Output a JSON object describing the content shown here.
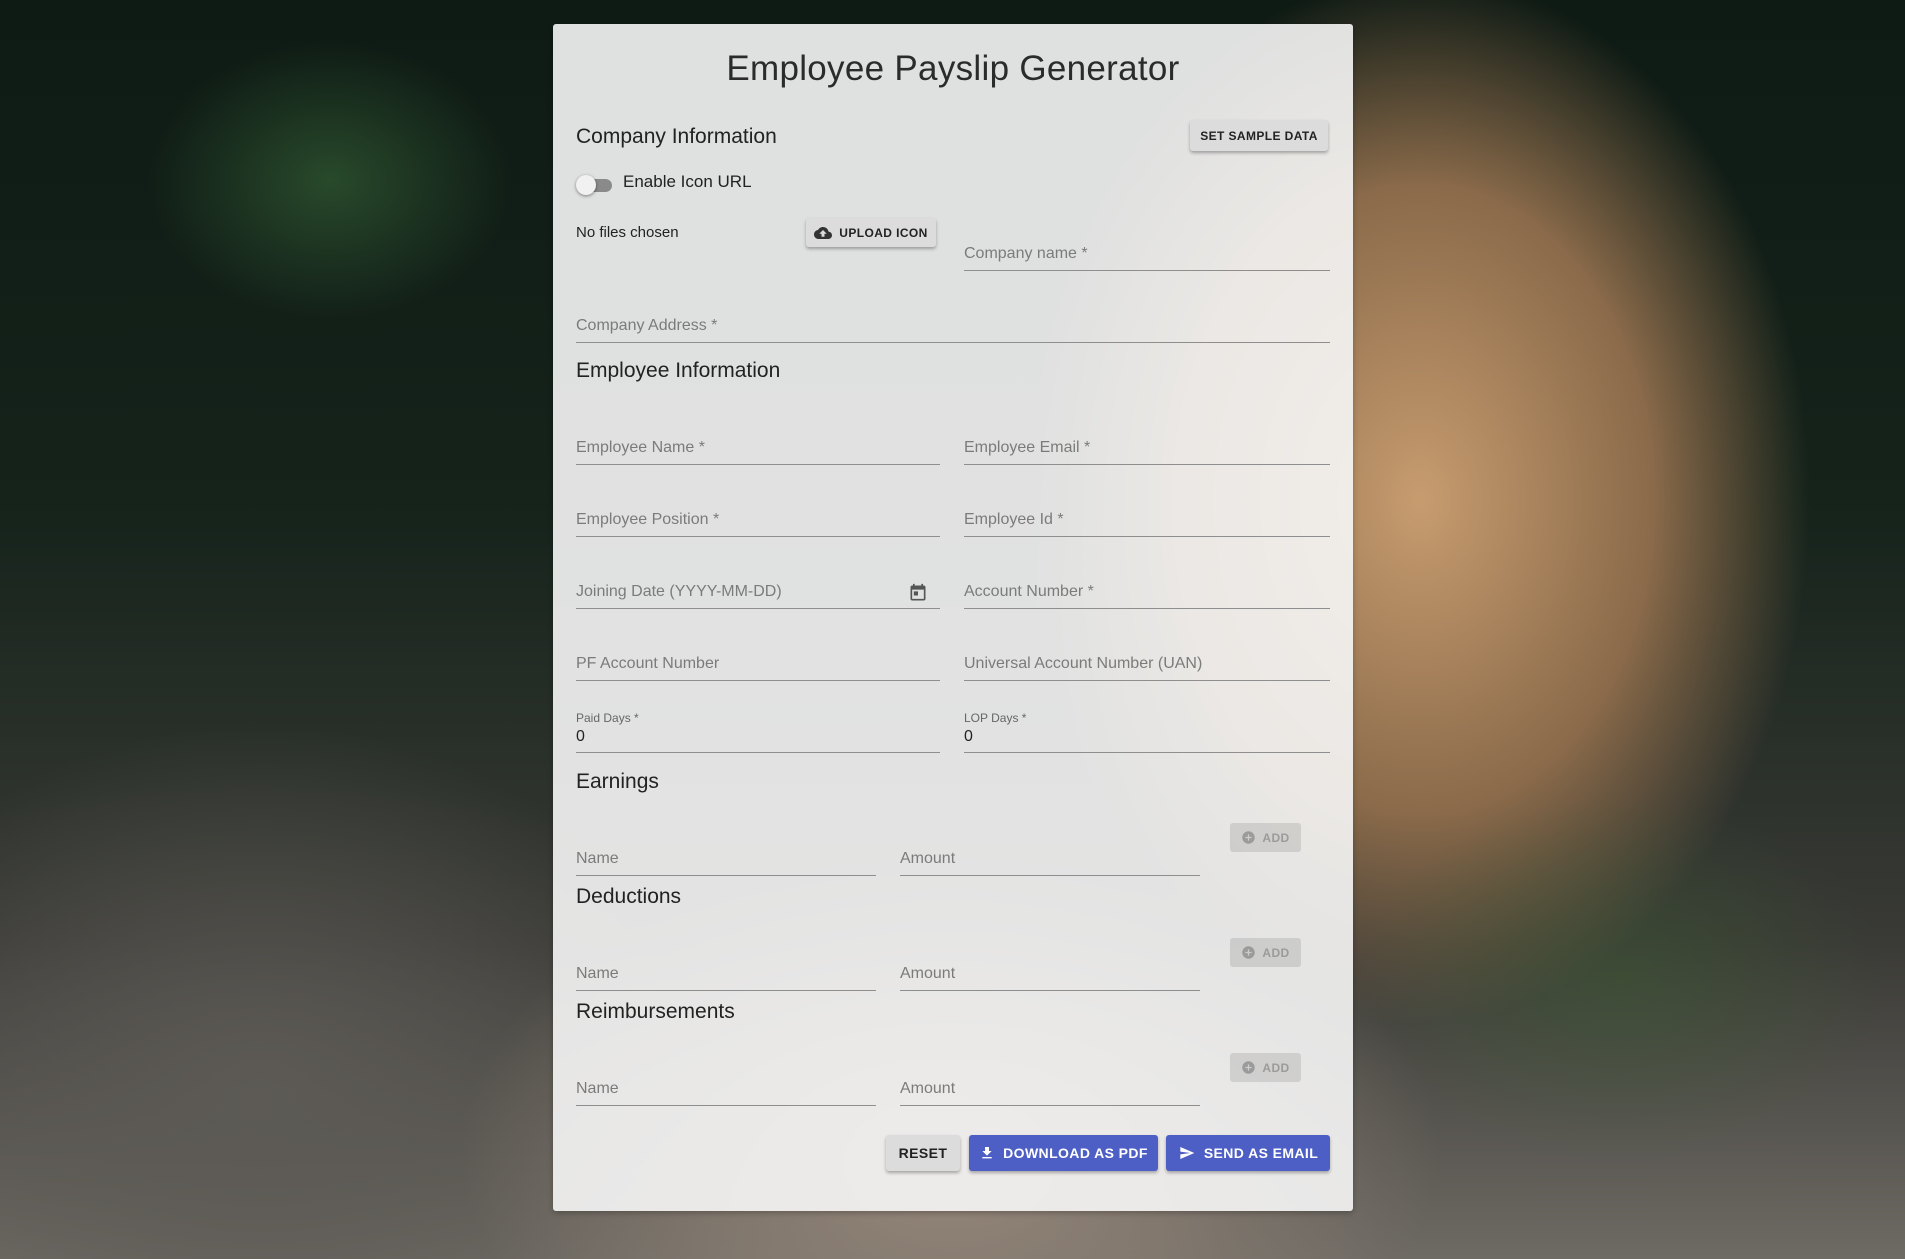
{
  "page": {
    "title": "Employee Payslip Generator"
  },
  "company": {
    "section_title": "Company Information",
    "sample_button": "SET SAMPLE DATA",
    "toggle_label": "Enable Icon URL",
    "toggle_on": false,
    "file_status": "No files chosen",
    "upload_button": "UPLOAD ICON",
    "name_placeholder": "Company name *",
    "address_placeholder": "Company Address *"
  },
  "employee": {
    "section_title": "Employee Information",
    "name_placeholder": "Employee Name *",
    "email_placeholder": "Employee Email *",
    "position_placeholder": "Employee Position *",
    "id_placeholder": "Employee Id *",
    "joining_placeholder": "Joining Date (YYYY-MM-DD)",
    "account_placeholder": "Account Number *",
    "pf_placeholder": "PF Account Number",
    "uan_placeholder": "Universal Account Number (UAN)",
    "paid_days_label": "Paid Days *",
    "paid_days_value": "0",
    "lop_days_label": "LOP Days *",
    "lop_days_value": "0"
  },
  "earnings": {
    "section_title": "Earnings",
    "name_placeholder": "Name",
    "amount_placeholder": "Amount",
    "add_button": "ADD"
  },
  "deductions": {
    "section_title": "Deductions",
    "name_placeholder": "Name",
    "amount_placeholder": "Amount",
    "add_button": "ADD"
  },
  "reimbursements": {
    "section_title": "Reimbursements",
    "name_placeholder": "Name",
    "amount_placeholder": "Amount",
    "add_button": "ADD"
  },
  "actions": {
    "reset": "RESET",
    "download_pdf": "DOWNLOAD AS PDF",
    "send_email": "SEND AS EMAIL"
  },
  "icons": {
    "upload": "cloud-upload-icon",
    "calendar": "calendar-icon",
    "add": "add-circle-icon",
    "download": "download-icon",
    "send": "send-icon"
  },
  "colors": {
    "primary": "#4d5fc4",
    "card_background": "#f6f6f6"
  }
}
